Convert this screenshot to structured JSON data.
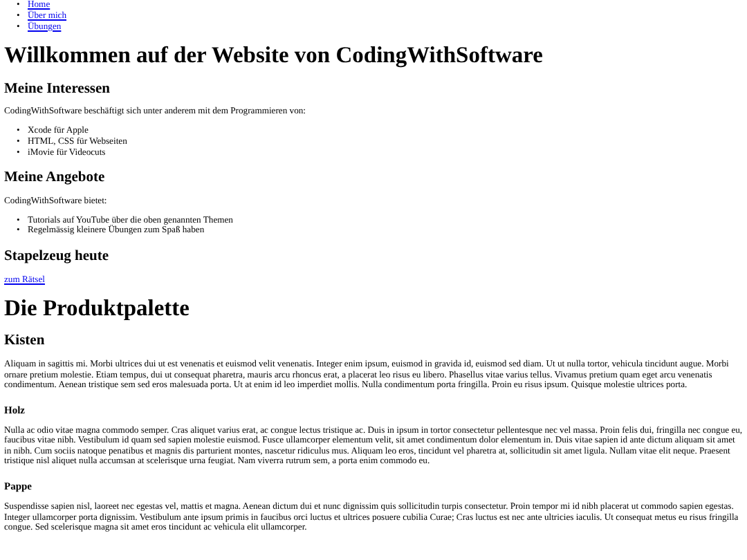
{
  "bullet": "•",
  "nav": [
    {
      "label": "Home"
    },
    {
      "label": "Über mich"
    },
    {
      "label": "Übungen"
    }
  ],
  "title": "Willkommen auf der Website von CodingWithSoftware",
  "sections": [
    {
      "heading": "Meine Interessen",
      "text": "CodingWithSoftware beschäftigt sich unter anderem mit dem Programmieren von:",
      "items": [
        "Xcode für Apple",
        "HTML, CSS für Webseiten",
        "iMovie für Videocuts"
      ]
    },
    {
      "heading": "Meine Angebote",
      "text": "CodingWithSoftware bietet:",
      "items": [
        "Tutorials auf YouTube über die oben genannten Themen",
        "Regelmässig kleinere Übungen zum Spaß haben"
      ]
    },
    {
      "heading": "Stapelzeug heute",
      "link": "zum Rätsel"
    }
  ],
  "products": {
    "title": "Die Produktpalette",
    "heading": "Kisten",
    "text": "Aliquam in sagittis mi. Morbi ultrices dui ut est venenatis et euismod velit venenatis. Integer enim ipsum, euismod in gravida id, euismod sed diam. Ut ut nulla tortor, vehicula tincidunt augue. Morbi ornare pretium molestie. Etiam tempus, dui ut consequat pharetra, mauris arcu rhoncus erat, a placerat leo risus eu libero. Phasellus vitae varius tellus. Vivamus pretium quam eget arcu venenatis condimentum. Aenean tristique sem sed eros malesuada porta. Ut at enim id leo imperdiet mollis. Nulla condimentum porta fringilla. Proin eu risus ipsum. Quisque molestie ultrices porta.",
    "subsections": [
      {
        "heading": "Holz",
        "text": "Nulla ac odio vitae magna commodo semper. Cras aliquet varius erat, ac congue lectus tristique ac. Duis in ipsum in tortor consectetur pellentesque nec vel massa. Proin felis dui, fringilla nec congue eu, faucibus vitae nibh. Vestibulum id quam sed sapien molestie euismod. Fusce ullamcorper elementum velit, sit amet condimentum dolor elementum in. Duis vitae sapien id ante dictum aliquam sit amet in nibh. Cum sociis natoque penatibus et magnis dis parturient montes, nascetur ridiculus mus. Aliquam leo eros, tincidunt vel pharetra at, sollicitudin sit amet ligula. Nullam vitae elit neque. Praesent tristique nisl aliquet nulla accumsan at scelerisque urna feugiat. Nam viverra rutrum sem, a porta enim commodo eu."
      },
      {
        "heading": "Pappe",
        "text": "Suspendisse sapien nisl, laoreet nec egestas vel, mattis et magna. Aenean dictum dui et nunc dignissim quis sollicitudin turpis consectetur. Proin tempor mi id nibh placerat ut commodo sapien egestas. Integer ullamcorper porta dignissim. Vestibulum ante ipsum primis in faucibus orci luctus et ultrices posuere cubilia Curae; Cras luctus est nec ante ultricies iaculis. Ut consequat metus eu risus fringilla congue. Sed scelerisque magna sit amet eros tincidunt ac vehicula elit ullamcorper."
      }
    ]
  }
}
